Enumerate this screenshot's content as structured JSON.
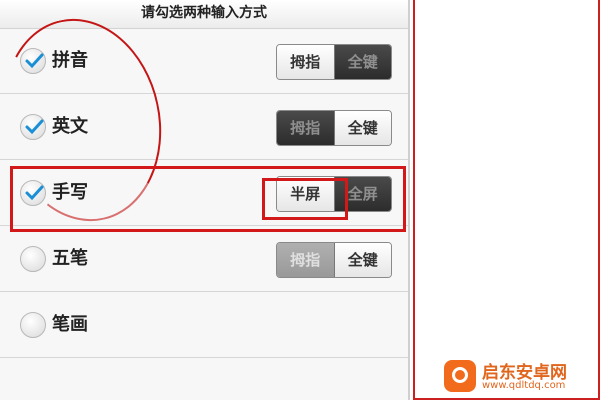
{
  "header": {
    "title": "请勾选两种输入方式"
  },
  "rows": [
    {
      "label": "拼音",
      "checked": true,
      "toggle": [
        "拇指",
        "全键"
      ],
      "active": 0,
      "style": "dark"
    },
    {
      "label": "英文",
      "checked": true,
      "toggle": [
        "拇指",
        "全键"
      ],
      "active": 1,
      "style": "dark"
    },
    {
      "label": "手写",
      "checked": true,
      "toggle": [
        "半屏",
        "全屏"
      ],
      "active": 0,
      "style": "dark"
    },
    {
      "label": "五笔",
      "checked": false,
      "toggle": [
        "拇指",
        "全键"
      ],
      "active": 1,
      "style": "light"
    },
    {
      "label": "笔画",
      "checked": false
    }
  ],
  "colors": {
    "annotation": "#d21818",
    "check": "#1a8fd6",
    "watermark": "#e0661e"
  },
  "watermark": {
    "title": "启东安卓网",
    "url": "www.qdltdq.com"
  }
}
